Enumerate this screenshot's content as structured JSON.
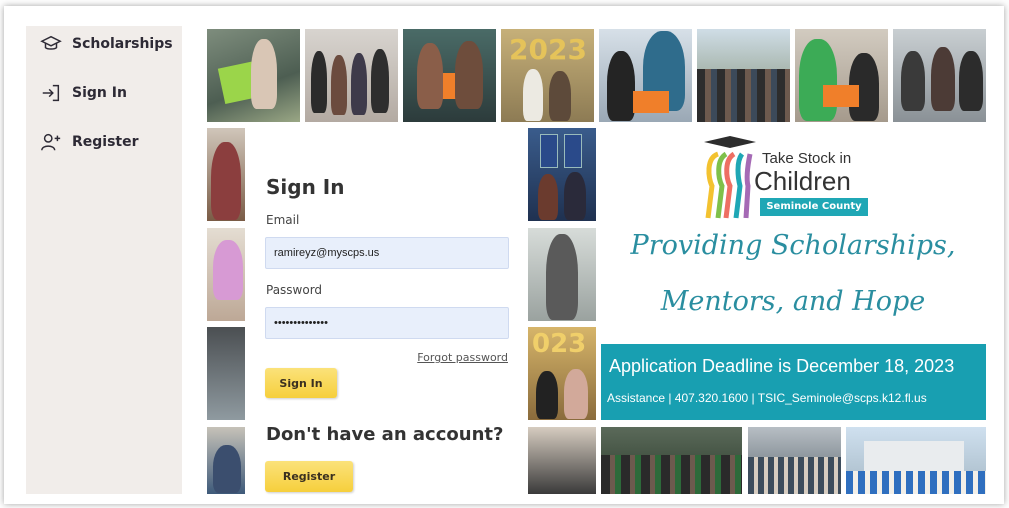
{
  "sidebar": {
    "items": [
      {
        "label": "Scholarships",
        "icon": "graduation-cap-icon"
      },
      {
        "label": "Sign In",
        "icon": "sign-in-icon"
      },
      {
        "label": "Register",
        "icon": "add-user-icon"
      }
    ]
  },
  "signin": {
    "heading": "Sign In",
    "email_label": "Email",
    "email_value": "ramireyz@myscps.us",
    "password_label": "Password",
    "password_value": "••••••••••••••",
    "forgot_label": "Forgot password",
    "submit_label": "Sign In",
    "no_account_heading": "Don't have an account?",
    "register_label": "Register"
  },
  "branding": {
    "org_line1": "Take Stock in",
    "org_line2": "Children",
    "org_line3": "Seminole County",
    "tagline1": "Providing Scholarships,",
    "tagline2": "Mentors, and Hope",
    "deadline": "Application Deadline is December 18, 2023",
    "assistance": "Assistance | 407.320.1600 | TSIC_Seminole@scps.k12.fl.us"
  },
  "colors": {
    "sidebar_bg": "#f1edea",
    "accent_teal": "#189fb1",
    "button_yellow": "#f6cf3c",
    "input_bg": "#e8effb"
  }
}
